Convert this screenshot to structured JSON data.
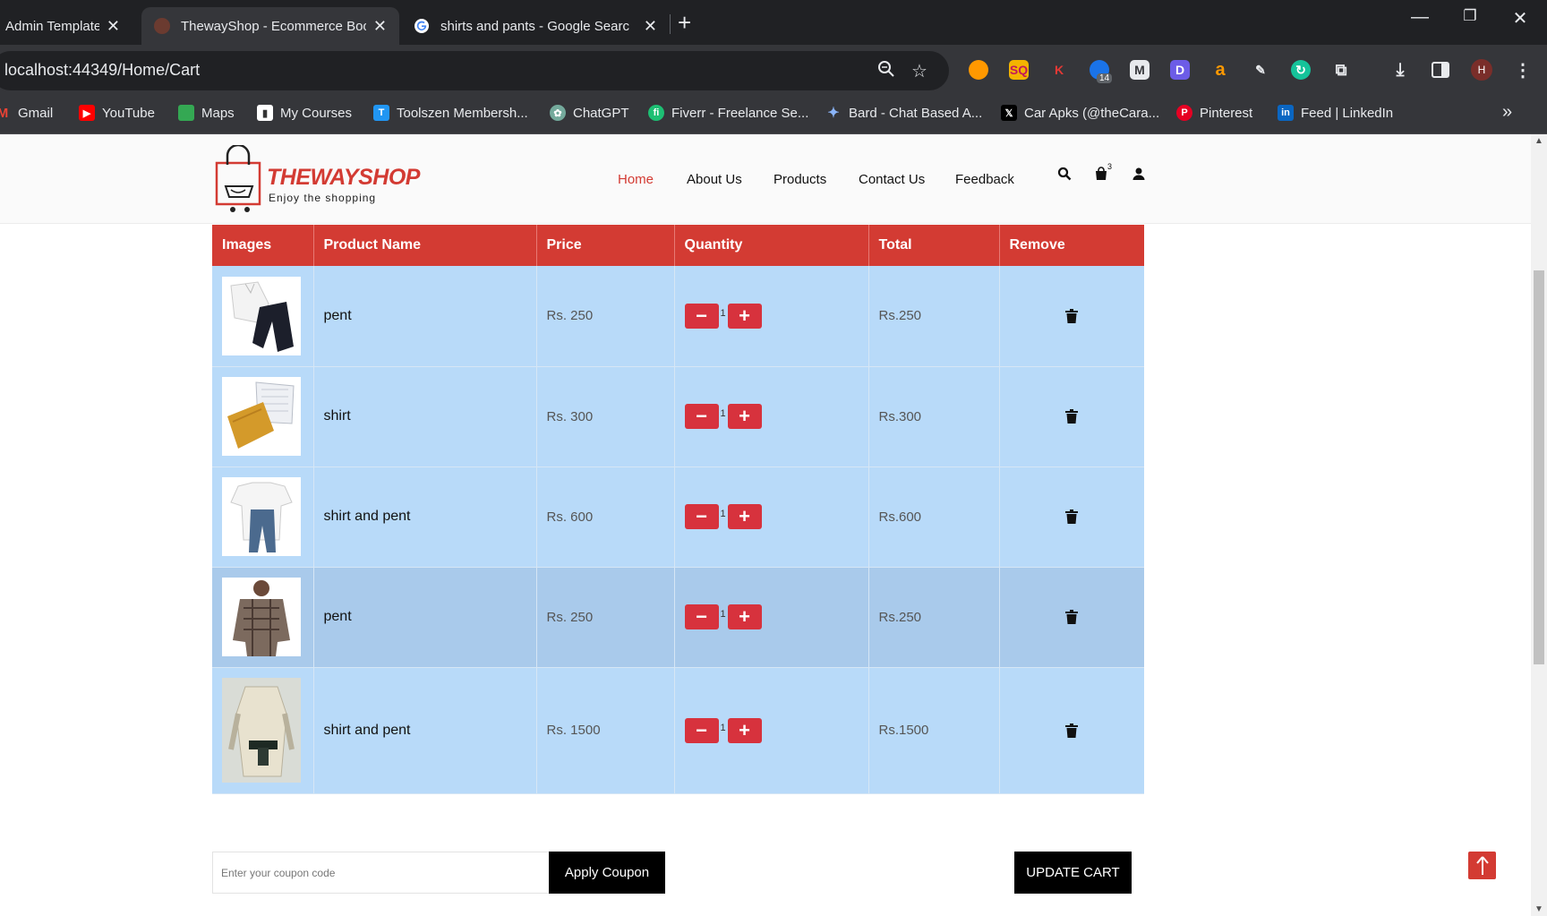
{
  "browser": {
    "tabs": [
      {
        "title": "Admin Template",
        "active": false
      },
      {
        "title": "ThewayShop - Ecommerce Boot",
        "active": true
      },
      {
        "title": "shirts and pants - Google Searc",
        "active": false
      }
    ],
    "url": "localhost:44349/Home/Cart",
    "profile_initial": "H",
    "extension_badge": "14",
    "bookmarks": [
      "Gmail",
      "YouTube",
      "Maps",
      "My Courses",
      "Toolszen Membersh...",
      "ChatGPT",
      "Fiverr - Freelance Se...",
      "Bard - Chat Based A...",
      "Car Apks (@theCara...",
      "Pinterest",
      "Feed | LinkedIn"
    ]
  },
  "site": {
    "logo_title": "THEWAYSHOP",
    "logo_tagline": "Enjoy the shopping",
    "nav": [
      "Home",
      "About Us",
      "Products",
      "Contact Us",
      "Feedback"
    ],
    "active_nav": "Home",
    "cart_count": "3",
    "accent_color": "#d33b33"
  },
  "cart": {
    "headers": [
      "Images",
      "Product Name",
      "Price",
      "Quantity",
      "Total",
      "Remove"
    ],
    "rows": [
      {
        "name": "pent",
        "price": "Rs. 250",
        "qty": "1",
        "total": "Rs.250",
        "image": "shirt-and-pants"
      },
      {
        "name": "shirt",
        "price": "Rs. 300",
        "qty": "1",
        "total": "Rs.300",
        "image": "folded-shirts"
      },
      {
        "name": "shirt and pent",
        "price": "Rs. 600",
        "qty": "1",
        "total": "Rs.600",
        "image": "tshirt-and-jeans"
      },
      {
        "name": "pent",
        "price": "Rs. 250",
        "qty": "1",
        "total": "Rs.250",
        "image": "plaid-shirt-man"
      },
      {
        "name": "shirt and pent",
        "price": "Rs. 1500",
        "qty": "1",
        "total": "Rs.1500",
        "image": "uniform-mannequin"
      }
    ]
  },
  "coupon": {
    "placeholder": "Enter your coupon code",
    "apply_label": "Apply Coupon"
  },
  "update_label": "UPDATE CART",
  "icons": {
    "minus": "minus-icon",
    "plus": "plus-icon",
    "trash": "trash-icon",
    "search": "search-icon",
    "bag": "shopping-bag-icon",
    "user": "user-icon",
    "to_top": "arrow-up-icon"
  }
}
